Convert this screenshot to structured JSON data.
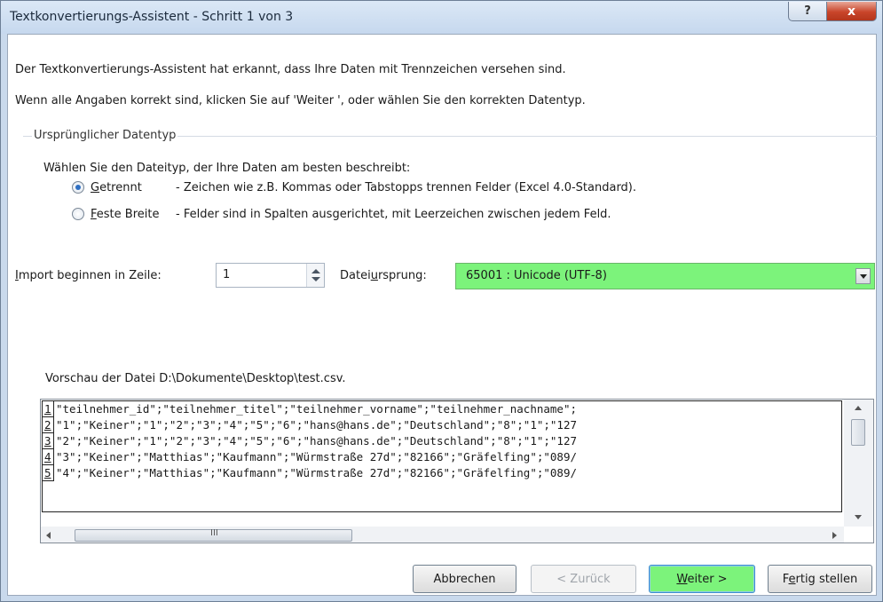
{
  "window": {
    "title": "Textkonvertierungs-Assistent - Schritt 1 von 3",
    "help_glyph": "?",
    "close_glyph": "x"
  },
  "intro": {
    "line1": "Der Textkonvertierungs-Assistent hat erkannt, dass Ihre Daten mit Trennzeichen versehen sind.",
    "line2": "Wenn alle Angaben korrekt sind, klicken Sie auf 'Weiter ', oder wählen Sie den korrekten Datentyp."
  },
  "datatype_group": {
    "title": "Ursprünglicher Datentyp",
    "prompt": "Wählen Sie den Dateityp, der Ihre Daten am besten beschreibt:",
    "options": [
      {
        "label_u": "G",
        "label_rest": "etrennt",
        "description": "- Zeichen wie z.B. Kommas oder Tabstopps trennen Felder (Excel 4.0-Standard).",
        "selected": true
      },
      {
        "label_u": "F",
        "label_rest": "este Breite",
        "description": "- Felder sind in Spalten ausgerichtet, mit Leerzeichen zwischen jedem Feld.",
        "selected": false
      }
    ]
  },
  "start_row": {
    "label_u": "I",
    "label_rest": "mport beginnen in Zeile:",
    "value": "1"
  },
  "origin": {
    "label_pre": "Datei",
    "label_u": "u",
    "label_post": "rsprung:",
    "value": "65001 : Unicode (UTF-8)",
    "highlight_color": "#7cf37b"
  },
  "preview": {
    "label": "Vorschau der Datei D:\\Dokumente\\Desktop\\test.csv.",
    "rows": [
      {
        "num": "1",
        "text": "\"teilnehmer_id\";\"teilnehmer_titel\";\"teilnehmer_vorname\";\"teilnehmer_nachname\";"
      },
      {
        "num": "2",
        "text": "\"1\";\"Keiner\";\"1\";\"2\";\"3\";\"4\";\"5\";\"6\";\"hans@hans.de\";\"Deutschland\";\"8\";\"1\";\"127"
      },
      {
        "num": "3",
        "text": "\"2\";\"Keiner\";\"1\";\"2\";\"3\";\"4\";\"5\";\"6\";\"hans@hans.de\";\"Deutschland\";\"8\";\"1\";\"127"
      },
      {
        "num": "4",
        "text": "\"3\";\"Keiner\";\"Matthias\";\"Kaufmann\";\"Würmstraße 27d\";\"82166\";\"Gräfelfing\";\"089/"
      },
      {
        "num": "5",
        "text": "\"4\";\"Keiner\";\"Matthias\";\"Kaufmann\";\"Würmstraße 27d\";\"82166\";\"Gräfelfing\";\"089/"
      }
    ],
    "hscroll_grip": "III"
  },
  "buttons": {
    "cancel": "Abbrechen",
    "back": "< Zurück",
    "next_u": "W",
    "next_rest": "eiter >",
    "finish_pre": "F",
    "finish_u": "e",
    "finish_post": "rtig stellen",
    "next_color": "#7cf37b"
  }
}
